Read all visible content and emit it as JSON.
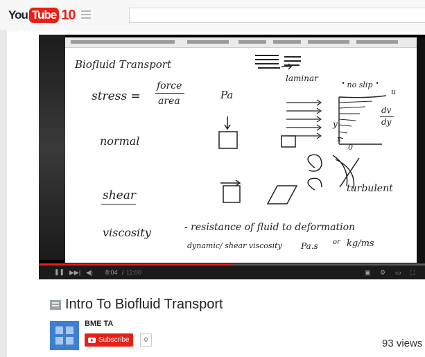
{
  "header": {
    "logo_you": "You",
    "logo_tube": "Tube",
    "logo_ten": "10",
    "search_placeholder": ""
  },
  "player": {
    "board_lines": {
      "title": "Biofluid Transport",
      "stress": "stress =",
      "force": "force",
      "area": "area",
      "unit_pa": "Pa",
      "laminar": "laminar",
      "no_slip": "\" no slip \"",
      "u": "u",
      "dv": "dv",
      "dy": "dy",
      "y": "y",
      "x": "x",
      "zero": "0",
      "normal": "normal",
      "shear": "shear",
      "turbulent": "turbulent",
      "viscosity": "viscosity",
      "viscosity_def": "- resistance of fluid to deformation",
      "dynamic": "dynamic/ shear viscosity",
      "pas": "Pa.s",
      "or": "or",
      "kgms": "kg/ms"
    },
    "time_current": "8:04",
    "time_total": "11:00",
    "progress": 0.5
  },
  "video": {
    "title": "Intro To Biofluid Transport"
  },
  "channel": {
    "name": "BME TA",
    "subscribe_label": "Subscribe",
    "subscriber_count": "0"
  },
  "stats": {
    "views": "93 views"
  },
  "colors": {
    "brand_red": "#e62117",
    "avatar_blue": "#3e7fd2"
  }
}
